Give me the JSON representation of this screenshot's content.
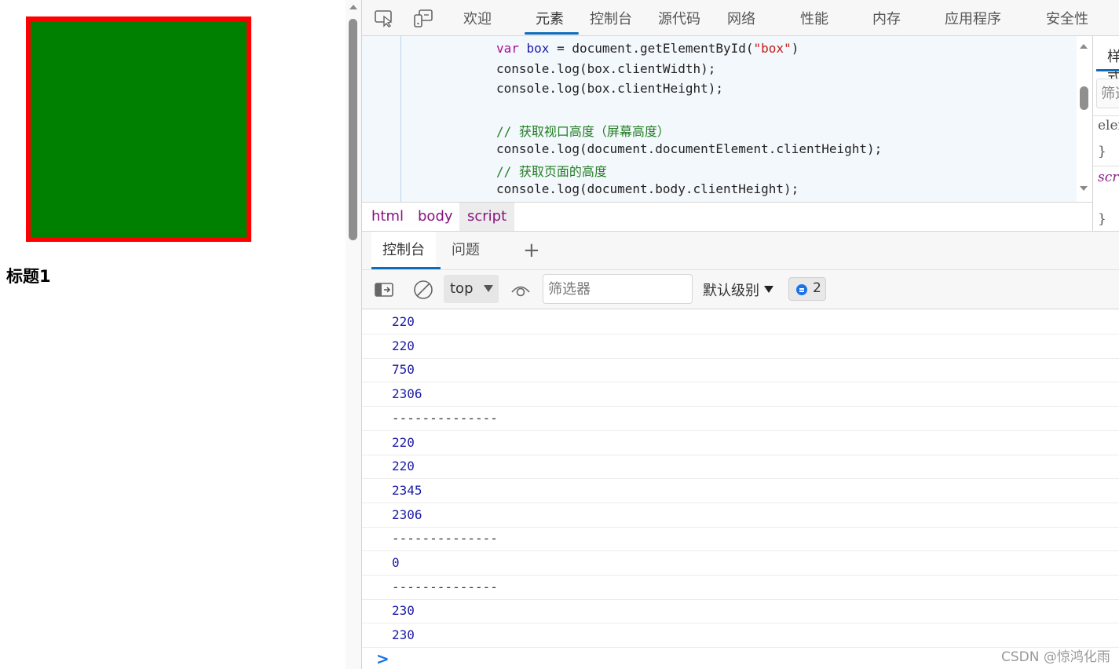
{
  "page": {
    "heading": "标题1",
    "box_colors": {
      "fill": "#008000",
      "border": "#ff0000"
    }
  },
  "devtools": {
    "tabs": [
      {
        "label": "欢迎"
      },
      {
        "label": "元素",
        "active": true
      },
      {
        "label": "控制台"
      },
      {
        "label": "源代码"
      },
      {
        "label": "网络"
      },
      {
        "label": "性能"
      },
      {
        "label": "内存"
      },
      {
        "label": "应用程序"
      },
      {
        "label": "安全性"
      }
    ],
    "toolbar_icons": [
      "inspect-element-icon",
      "device-emulation-icon"
    ],
    "accent_color": "#0f6cbd",
    "source": {
      "lines": [
        {
          "parts": [
            {
              "t": "var ",
              "c": "kw"
            },
            {
              "t": "box",
              "c": "var"
            },
            {
              "t": " = document.getElementById(",
              "c": ""
            },
            {
              "t": "\"box\"",
              "c": "str"
            },
            {
              "t": ")",
              "c": ""
            }
          ]
        },
        {
          "parts": [
            {
              "t": "console.log(box.clientWidth);",
              "c": ""
            }
          ]
        },
        {
          "parts": [
            {
              "t": "console.log(box.clientHeight);",
              "c": ""
            }
          ]
        },
        {
          "parts": [
            {
              "t": "",
              "c": ""
            }
          ]
        },
        {
          "parts": [
            {
              "t": "// 获取视口高度（屏幕高度）",
              "c": "cm"
            }
          ]
        },
        {
          "parts": [
            {
              "t": "console.log(document.documentElement.clientHeight);",
              "c": ""
            }
          ]
        },
        {
          "parts": [
            {
              "t": "// 获取页面的高度",
              "c": "cm"
            }
          ]
        },
        {
          "parts": [
            {
              "t": "console.log(document.body.clientHeight);",
              "c": ""
            }
          ]
        }
      ]
    },
    "styles_panel": {
      "tab_label": "样式",
      "filter_placeholder": "筛选",
      "rule1_selector": "element.style {",
      "rule1_close": "}",
      "rule2_selector": "script {",
      "rule2_close": "}"
    },
    "breadcrumb": [
      {
        "label": "html"
      },
      {
        "label": "body"
      },
      {
        "label": "script",
        "active": true
      }
    ],
    "drawer": {
      "tabs": [
        {
          "label": "控制台",
          "active": true
        },
        {
          "label": "问题"
        }
      ],
      "add_tab": "+"
    },
    "console_toolbar": {
      "context": "top",
      "filter_placeholder": "筛选器",
      "filter_value": "",
      "level_label": "默认级别",
      "issues_count": "2"
    },
    "console_messages": [
      "220",
      "220",
      "750",
      "2306",
      "--------------",
      "220",
      "220",
      "2345",
      "2306",
      "--------------",
      "0",
      "--------------",
      "230",
      "230"
    ],
    "prompt": ">",
    "watermark": "CSDN @惊鸿化雨"
  }
}
